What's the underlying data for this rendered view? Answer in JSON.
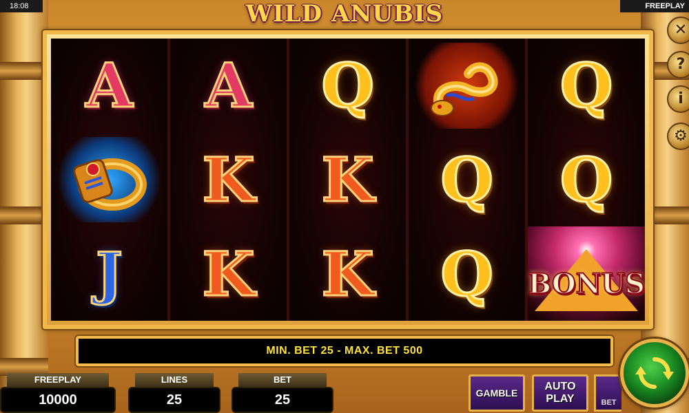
{
  "status_bar": {
    "clock": "18:08",
    "mode": "FREEPLAY"
  },
  "game": {
    "title": "WILD ANUBIS"
  },
  "side_buttons": [
    {
      "icon": "close-icon",
      "glyph": "✕"
    },
    {
      "icon": "help-icon",
      "glyph": "?"
    },
    {
      "icon": "info-icon",
      "glyph": "i"
    },
    {
      "icon": "gear-icon",
      "glyph": "⚙"
    }
  ],
  "reels": [
    [
      {
        "symbol": "A",
        "kind": "letter"
      },
      {
        "symbol": "ring",
        "kind": "ring"
      },
      {
        "symbol": "J",
        "kind": "letter"
      }
    ],
    [
      {
        "symbol": "A",
        "kind": "letter"
      },
      {
        "symbol": "K",
        "kind": "letter"
      },
      {
        "symbol": "K",
        "kind": "letter"
      }
    ],
    [
      {
        "symbol": "Q",
        "kind": "letter"
      },
      {
        "symbol": "K",
        "kind": "letter"
      },
      {
        "symbol": "K",
        "kind": "letter"
      }
    ],
    [
      {
        "symbol": "snake",
        "kind": "snake"
      },
      {
        "symbol": "Q",
        "kind": "letter"
      },
      {
        "symbol": "Q",
        "kind": "letter"
      }
    ],
    [
      {
        "symbol": "Q",
        "kind": "letter"
      },
      {
        "symbol": "Q",
        "kind": "letter"
      },
      {
        "symbol": "BONUS",
        "kind": "bonus"
      }
    ]
  ],
  "message": "MIN. BET 25 - MAX. BET 500",
  "panels": {
    "balance": {
      "label": "FREEPLAY",
      "value": "10000"
    },
    "lines": {
      "label": "LINES",
      "value": "25"
    },
    "bet": {
      "label": "BET",
      "value": "25"
    }
  },
  "buttons": {
    "gamble": "GAMBLE",
    "autoplay_line1": "AUTO",
    "autoplay_line2": "PLAY",
    "bet_stub": "BET"
  },
  "colors": {
    "gold_frame": "#f0b94a",
    "message_text": "#ffe33a",
    "button_purple": "#5a2a8a",
    "spin_green": "#1a8a22"
  }
}
